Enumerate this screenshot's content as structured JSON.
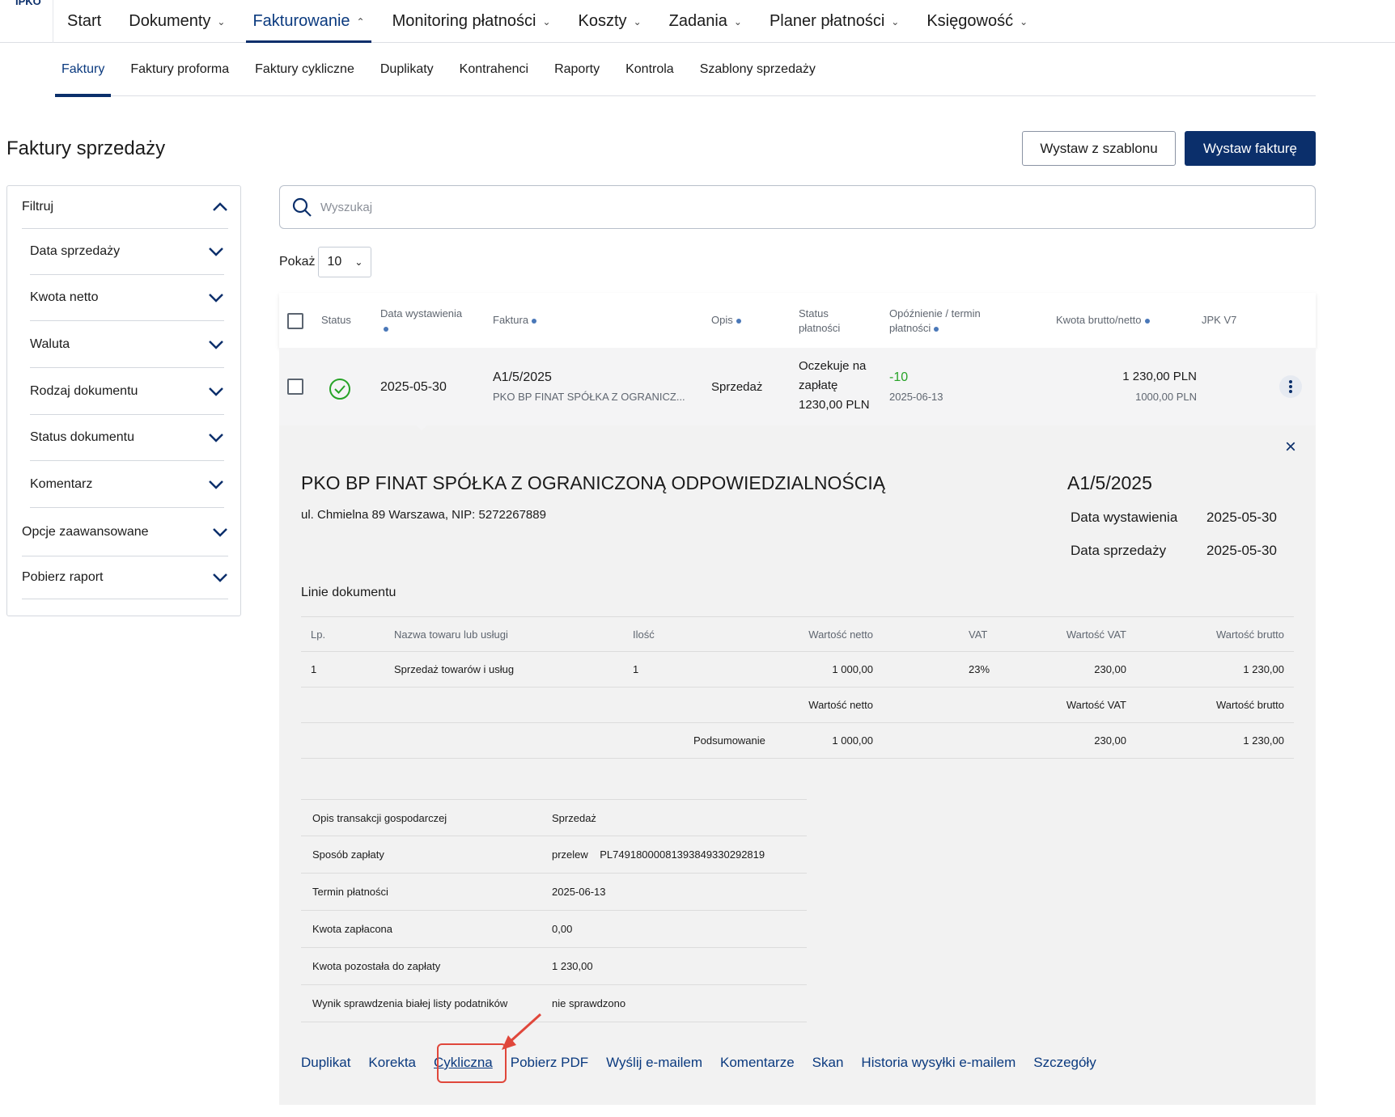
{
  "brand": "IPKO",
  "topnav": [
    {
      "label": "Start",
      "chevron": false,
      "active": false
    },
    {
      "label": "Dokumenty",
      "chevron": true,
      "active": false
    },
    {
      "label": "Fakturowanie",
      "chevron": true,
      "active": true
    },
    {
      "label": "Monitoring płatności",
      "chevron": true,
      "active": false
    },
    {
      "label": "Koszty",
      "chevron": true,
      "active": false
    },
    {
      "label": "Zadania",
      "chevron": true,
      "active": false
    },
    {
      "label": "Planer płatności",
      "chevron": true,
      "active": false
    },
    {
      "label": "Księgowość",
      "chevron": true,
      "active": false
    }
  ],
  "subnav": [
    {
      "label": "Faktury",
      "active": true
    },
    {
      "label": "Faktury proforma",
      "active": false
    },
    {
      "label": "Faktury cykliczne",
      "active": false
    },
    {
      "label": "Duplikaty",
      "active": false
    },
    {
      "label": "Kontrahenci",
      "active": false
    },
    {
      "label": "Raporty",
      "active": false
    },
    {
      "label": "Kontrola",
      "active": false
    },
    {
      "label": "Szablony sprzedaży",
      "active": false
    }
  ],
  "page_title": "Faktury sprzedaży",
  "buttons": {
    "from_template": "Wystaw z szablonu",
    "issue_invoice": "Wystaw fakturę"
  },
  "filters": {
    "title": "Filtruj",
    "items": [
      "Data sprzedaży",
      "Kwota netto",
      "Waluta",
      "Rodzaj dokumentu",
      "Status dokumentu",
      "Komentarz"
    ],
    "advanced": "Opcje zaawansowane",
    "report": "Pobierz raport"
  },
  "search": {
    "placeholder": "Wyszukaj"
  },
  "show": {
    "label": "Pokaż",
    "value": "10"
  },
  "table": {
    "headers": {
      "status": "Status",
      "issue_date": "Data wystawienia",
      "invoice": "Faktura",
      "desc": "Opis",
      "payment_status": "Status płatności",
      "delay": "Opóźnienie / termin płatności",
      "amount": "Kwota brutto/netto",
      "jpk": "JPK V7"
    },
    "row": {
      "issue_date": "2025-05-30",
      "invoice_no": "A1/5/2025",
      "contractor": "PKO BP FINAT SPÓŁKA Z OGRANICZ...",
      "desc": "Sprzedaż",
      "payment_status": [
        "Oczekuje na",
        "zapłatę",
        "1230,00 PLN"
      ],
      "delay": "-10",
      "due_date": "2025-06-13",
      "gross": "1 230,00 PLN",
      "net": "1000,00 PLN"
    }
  },
  "detail": {
    "contractor": "PKO BP FINAT SPÓŁKA Z OGRANICZONĄ ODPOWIEDZIALNOŚCIĄ",
    "address": "ul. Chmielna 89 Warszawa, NIP: 5272267889",
    "invoice_no": "A1/5/2025",
    "issue_date_label": "Data wystawienia",
    "issue_date": "2025-05-30",
    "sale_date_label": "Data sprzedaży",
    "sale_date": "2025-05-30",
    "lines_title": "Linie dokumentu",
    "lines_headers": {
      "lp": "Lp.",
      "name": "Nazwa towaru lub usługi",
      "qty": "Ilość",
      "net": "Wartość netto",
      "vat": "VAT",
      "vat_value": "Wartość VAT",
      "gross": "Wartość brutto"
    },
    "line": {
      "lp": "1",
      "name": "Sprzedaż towarów i usług",
      "qty": "1",
      "net": "1 000,00",
      "vat": "23%",
      "vat_value": "230,00",
      "gross": "1 230,00"
    },
    "summary_headers": {
      "net": "Wartość netto",
      "vat_value": "Wartość VAT",
      "gross": "Wartość brutto"
    },
    "summary": {
      "label": "Podsumowanie",
      "net": "1 000,00",
      "vat_value": "230,00",
      "gross": "1 230,00"
    },
    "info": [
      {
        "k": "Opis transakcji gospodarczej",
        "v": "Sprzedaż"
      },
      {
        "k": "Sposób zapłaty",
        "v": "przelew    PL74918000081393849330292819"
      },
      {
        "k": "Termin płatności",
        "v": "2025-06-13"
      },
      {
        "k": "Kwota zapłacona",
        "v": "0,00"
      },
      {
        "k": "Kwota pozostała do zapłaty",
        "v": "1 230,00"
      },
      {
        "k": "Wynik sprawdzenia białej listy podatników",
        "v": "nie sprawdzono"
      }
    ],
    "actions": [
      "Duplikat",
      "Korekta",
      "Cykliczna",
      "Pobierz PDF",
      "Wyślij e-mailem",
      "Komentarze",
      "Skan",
      "Historia wysyłki e-mailem",
      "Szczegóły"
    ]
  },
  "colors": {
    "brand": "#0b2f6b",
    "positive": "#27a327",
    "highlight": "#e0473b",
    "panel": "#f2f2f2"
  }
}
